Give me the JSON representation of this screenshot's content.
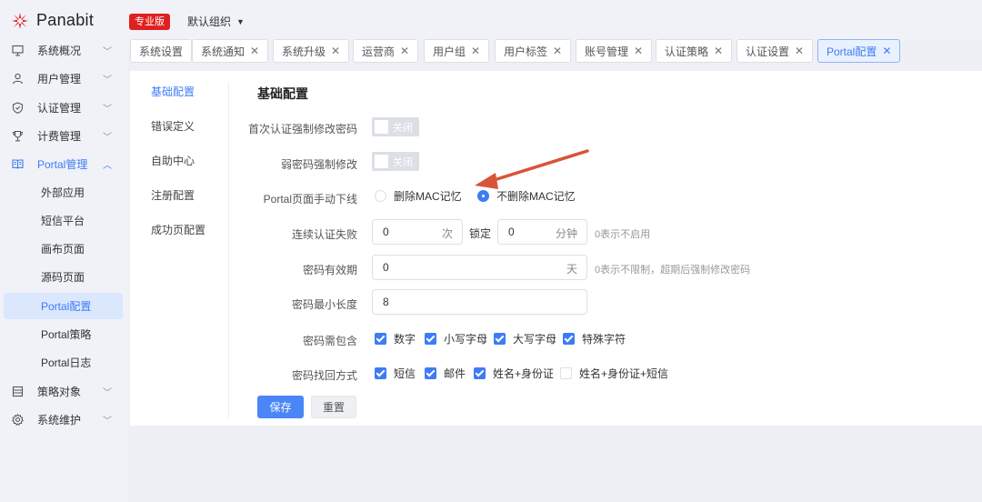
{
  "colors": {
    "accent": "#3d7cf5",
    "brand_badge": "#e02020",
    "arrow": "#d9533a"
  },
  "header": {
    "app_name": "Panabit",
    "edition_badge": "专业版",
    "org_selector": "默认组织"
  },
  "sidebar": {
    "items": [
      {
        "label": "系统概况",
        "icon": "monitor-icon"
      },
      {
        "label": "用户管理",
        "icon": "user-icon"
      },
      {
        "label": "认证管理",
        "icon": "shield-icon"
      },
      {
        "label": "计费管理",
        "icon": "trophy-icon"
      },
      {
        "label": "Portal管理",
        "icon": "book-icon"
      },
      {
        "label": "策略对象",
        "icon": "list-icon"
      },
      {
        "label": "系统维护",
        "icon": "gear-icon"
      }
    ],
    "portal_subitems": [
      "外部应用",
      "短信平台",
      "画布页面",
      "源码页面",
      "Portal配置",
      "Portal策略",
      "Portal日志"
    ]
  },
  "tabs": [
    {
      "label": "系统设置",
      "closable": false
    },
    {
      "label": "系统通知",
      "closable": true
    },
    {
      "label": "系统升级",
      "closable": true
    },
    {
      "label": "运营商",
      "closable": true
    },
    {
      "label": "用户组",
      "closable": true
    },
    {
      "label": "用户标签",
      "closable": true
    },
    {
      "label": "账号管理",
      "closable": true
    },
    {
      "label": "认证策略",
      "closable": true
    },
    {
      "label": "认证设置",
      "closable": true
    },
    {
      "label": "Portal配置",
      "closable": true
    }
  ],
  "subnav": [
    "基础配置",
    "错误定义",
    "自助中心",
    "注册配置",
    "成功页配置"
  ],
  "form": {
    "section_title": "基础配置",
    "first_auth_pw_change": {
      "label": "首次认证强制修改密码",
      "state": "关闭"
    },
    "weak_pw_change": {
      "label": "弱密码强制修改",
      "state": "关闭"
    },
    "portal_logout": {
      "label": "Portal页面手动下线",
      "option_delete": "删除MAC记忆",
      "option_keep": "不删除MAC记忆"
    },
    "auth_fail": {
      "label": "连续认证失败",
      "count": "0",
      "count_unit": "次",
      "lock_label": "锁定",
      "lock_value": "0",
      "lock_unit": "分钟",
      "hint": "0表示不启用"
    },
    "pw_validity": {
      "label": "密码有效期",
      "value": "0",
      "unit": "天",
      "hint": "0表示不限制，超期后强制修改密码"
    },
    "pw_min_len": {
      "label": "密码最小长度",
      "value": "8"
    },
    "pw_contains": {
      "label": "密码需包含",
      "options": [
        "数字",
        "小写字母",
        "大写字母",
        "特殊字符"
      ]
    },
    "pw_recovery": {
      "label": "密码找回方式",
      "options": [
        "短信",
        "邮件",
        "姓名+身份证",
        "姓名+身份证+短信"
      ]
    },
    "save": "保存",
    "reset": "重置"
  },
  "close_glyph": "✕",
  "caret_glyph": "▼"
}
